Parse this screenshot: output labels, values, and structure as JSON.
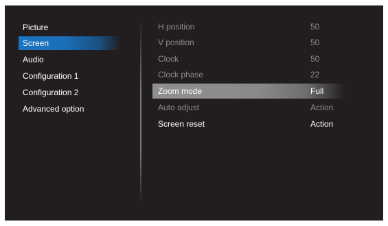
{
  "menu": {
    "items": [
      {
        "label": "Picture"
      },
      {
        "label": "Screen"
      },
      {
        "label": "Audio"
      },
      {
        "label": "Configuration 1"
      },
      {
        "label": "Configuration 2"
      },
      {
        "label": "Advanced option"
      }
    ],
    "selected": "Screen"
  },
  "settings": {
    "rows": [
      {
        "label": "H position",
        "value": "50"
      },
      {
        "label": "V position",
        "value": "50"
      },
      {
        "label": "Clock",
        "value": "50"
      },
      {
        "label": "Clock phase",
        "value": "22"
      },
      {
        "label": "Zoom mode",
        "value": "Full"
      },
      {
        "label": "Auto adjust",
        "value": "Action"
      },
      {
        "label": "Screen reset",
        "value": "Action"
      }
    ],
    "highlighted": "Zoom mode"
  },
  "colors": {
    "background": "#221e1f",
    "selection_blue": "#1a74c2",
    "highlight_gray": "#8f8f8f",
    "dim_text": "#8e8c8d"
  }
}
